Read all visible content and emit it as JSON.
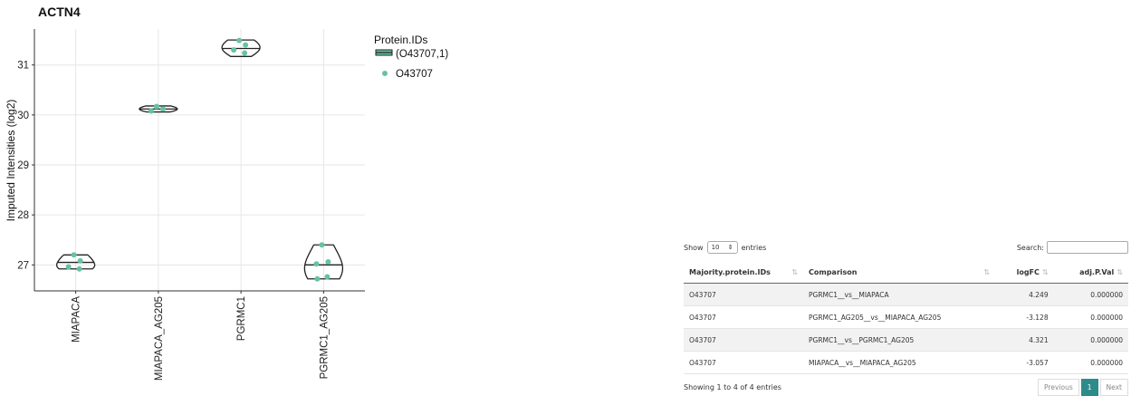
{
  "chart_data": {
    "type": "violin",
    "title": "ACTN4",
    "ylabel": "Imputed Intensities (log2)",
    "xlabel": "",
    "categories": [
      "MIAPACA",
      "MIAPACA_AG205",
      "PGRMC1",
      "PGRMC1_AG205"
    ],
    "ylim": [
      26.48,
      31.72
    ],
    "yticks": [
      27,
      28,
      29,
      30,
      31
    ],
    "grid": true,
    "legend_placement": "right",
    "legend": {
      "title": "Protein.IDs",
      "entries": [
        {
          "label": "(O43707,1)",
          "kind": "violin-line"
        },
        {
          "label": "O43707",
          "kind": "point"
        }
      ]
    },
    "series": [
      {
        "category": "MIAPACA",
        "points": [
          27.2,
          27.08,
          26.96,
          26.92
        ],
        "violin_min": 26.92,
        "violin_max": 27.2,
        "median": 27.05
      },
      {
        "category": "MIAPACA_AG205",
        "points": [
          30.17,
          30.12,
          30.08
        ],
        "violin_min": 30.06,
        "violin_max": 30.18,
        "median": 30.12
      },
      {
        "category": "PGRMC1",
        "points": [
          31.49,
          31.4,
          31.3,
          31.24
        ],
        "violin_min": 31.17,
        "violin_max": 31.5,
        "median": 31.33
      },
      {
        "category": "PGRMC1_AG205",
        "points": [
          27.4,
          27.06,
          27.02,
          26.76,
          26.72
        ],
        "violin_min": 26.72,
        "violin_max": 27.4,
        "median": 27.0
      }
    ],
    "point_color": "#66c2a5",
    "outline_color": "#222222"
  },
  "table": {
    "show_label": "Show",
    "length_value": "10",
    "entries_label": "entries",
    "search_label": "Search:",
    "columns": [
      "Majority.protein.IDs",
      "Comparison",
      "logFC",
      "adj.P.Val"
    ],
    "rows": [
      [
        "O43707",
        "PGRMC1__vs__MIAPACA",
        "4.249",
        "0.000000"
      ],
      [
        "O43707",
        "PGRMC1_AG205__vs__MIAPACA_AG205",
        "-3.128",
        "0.000000"
      ],
      [
        "O43707",
        "PGRMC1__vs__PGRMC1_AG205",
        "4.321",
        "0.000000"
      ],
      [
        "O43707",
        "MIAPACA__vs__MIAPACA_AG205",
        "-3.057",
        "0.000000"
      ]
    ],
    "info": "Showing 1 to 4 of 4 entries",
    "prev_label": "Previous",
    "page_label": "1",
    "next_label": "Next"
  }
}
